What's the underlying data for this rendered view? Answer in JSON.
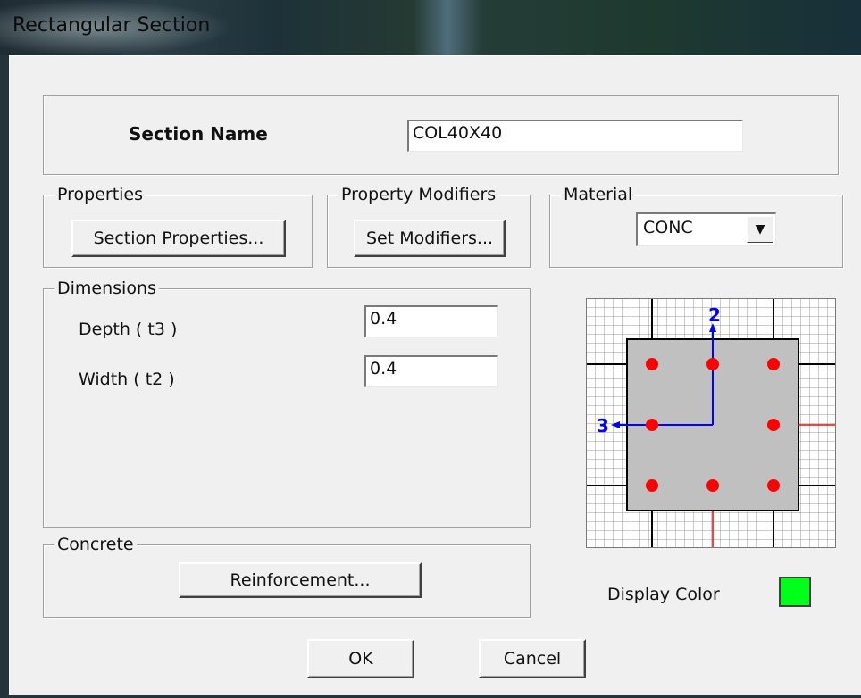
{
  "window": {
    "title": "Rectangular Section"
  },
  "section_name": {
    "label": "Section Name",
    "value": "COL40X40"
  },
  "properties": {
    "legend": "Properties",
    "button": "Section Properties..."
  },
  "modifiers": {
    "legend": "Property Modifiers",
    "button": "Set Modifiers..."
  },
  "material": {
    "legend": "Material",
    "selected": "CONC"
  },
  "dimensions": {
    "legend": "Dimensions",
    "depth_label": "Depth  ( t3 )",
    "depth_value": "0.4",
    "width_label": "Width  ( t2 )",
    "width_value": "0.4"
  },
  "concrete": {
    "legend": "Concrete",
    "button": "Reinforcement..."
  },
  "preview": {
    "axis_2": "2",
    "axis_3": "3",
    "rebar_color": "#ff0000",
    "section_fill": "#c0c0c0",
    "axis_color": "#0000ff"
  },
  "display_color": {
    "label": "Display Color",
    "color": "#00ff19"
  },
  "footer": {
    "ok": "OK",
    "cancel": "Cancel"
  }
}
